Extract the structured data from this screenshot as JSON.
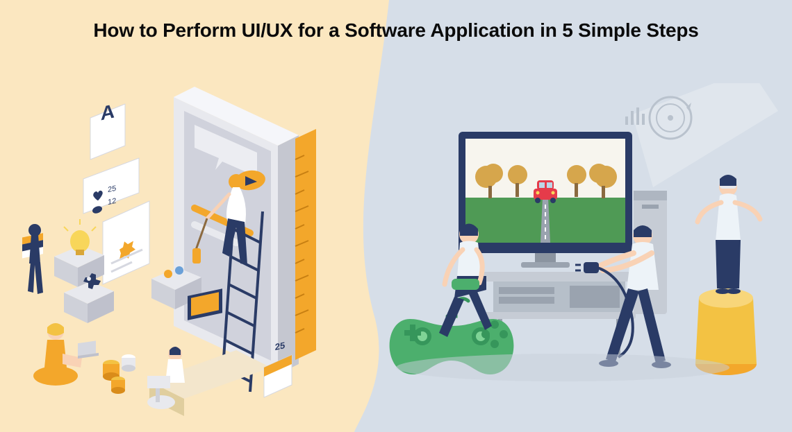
{
  "title": "How to Perform UI/UX for a Software Application in 5 Simple Steps",
  "left": {
    "letter_card": "A",
    "heart_count": "25",
    "comment_count": "12",
    "calendar_day": "25"
  },
  "right": {},
  "colors": {
    "left_bg": "#fbe7c0",
    "right_bg": "#d6dee8",
    "orange": "#f3a72b",
    "dark_orange": "#d98c1a",
    "blue": "#2a3b66",
    "skin": "#f9d2b5",
    "white": "#ffffff",
    "green": "#4caf6d",
    "dark_green": "#36965b",
    "red": "#e53b4a",
    "tree": "#d6a64c",
    "grass": "#4f9a55",
    "gray": "#b6bfc9",
    "dark_gray": "#8b94a0",
    "navy": "#283a5c"
  }
}
